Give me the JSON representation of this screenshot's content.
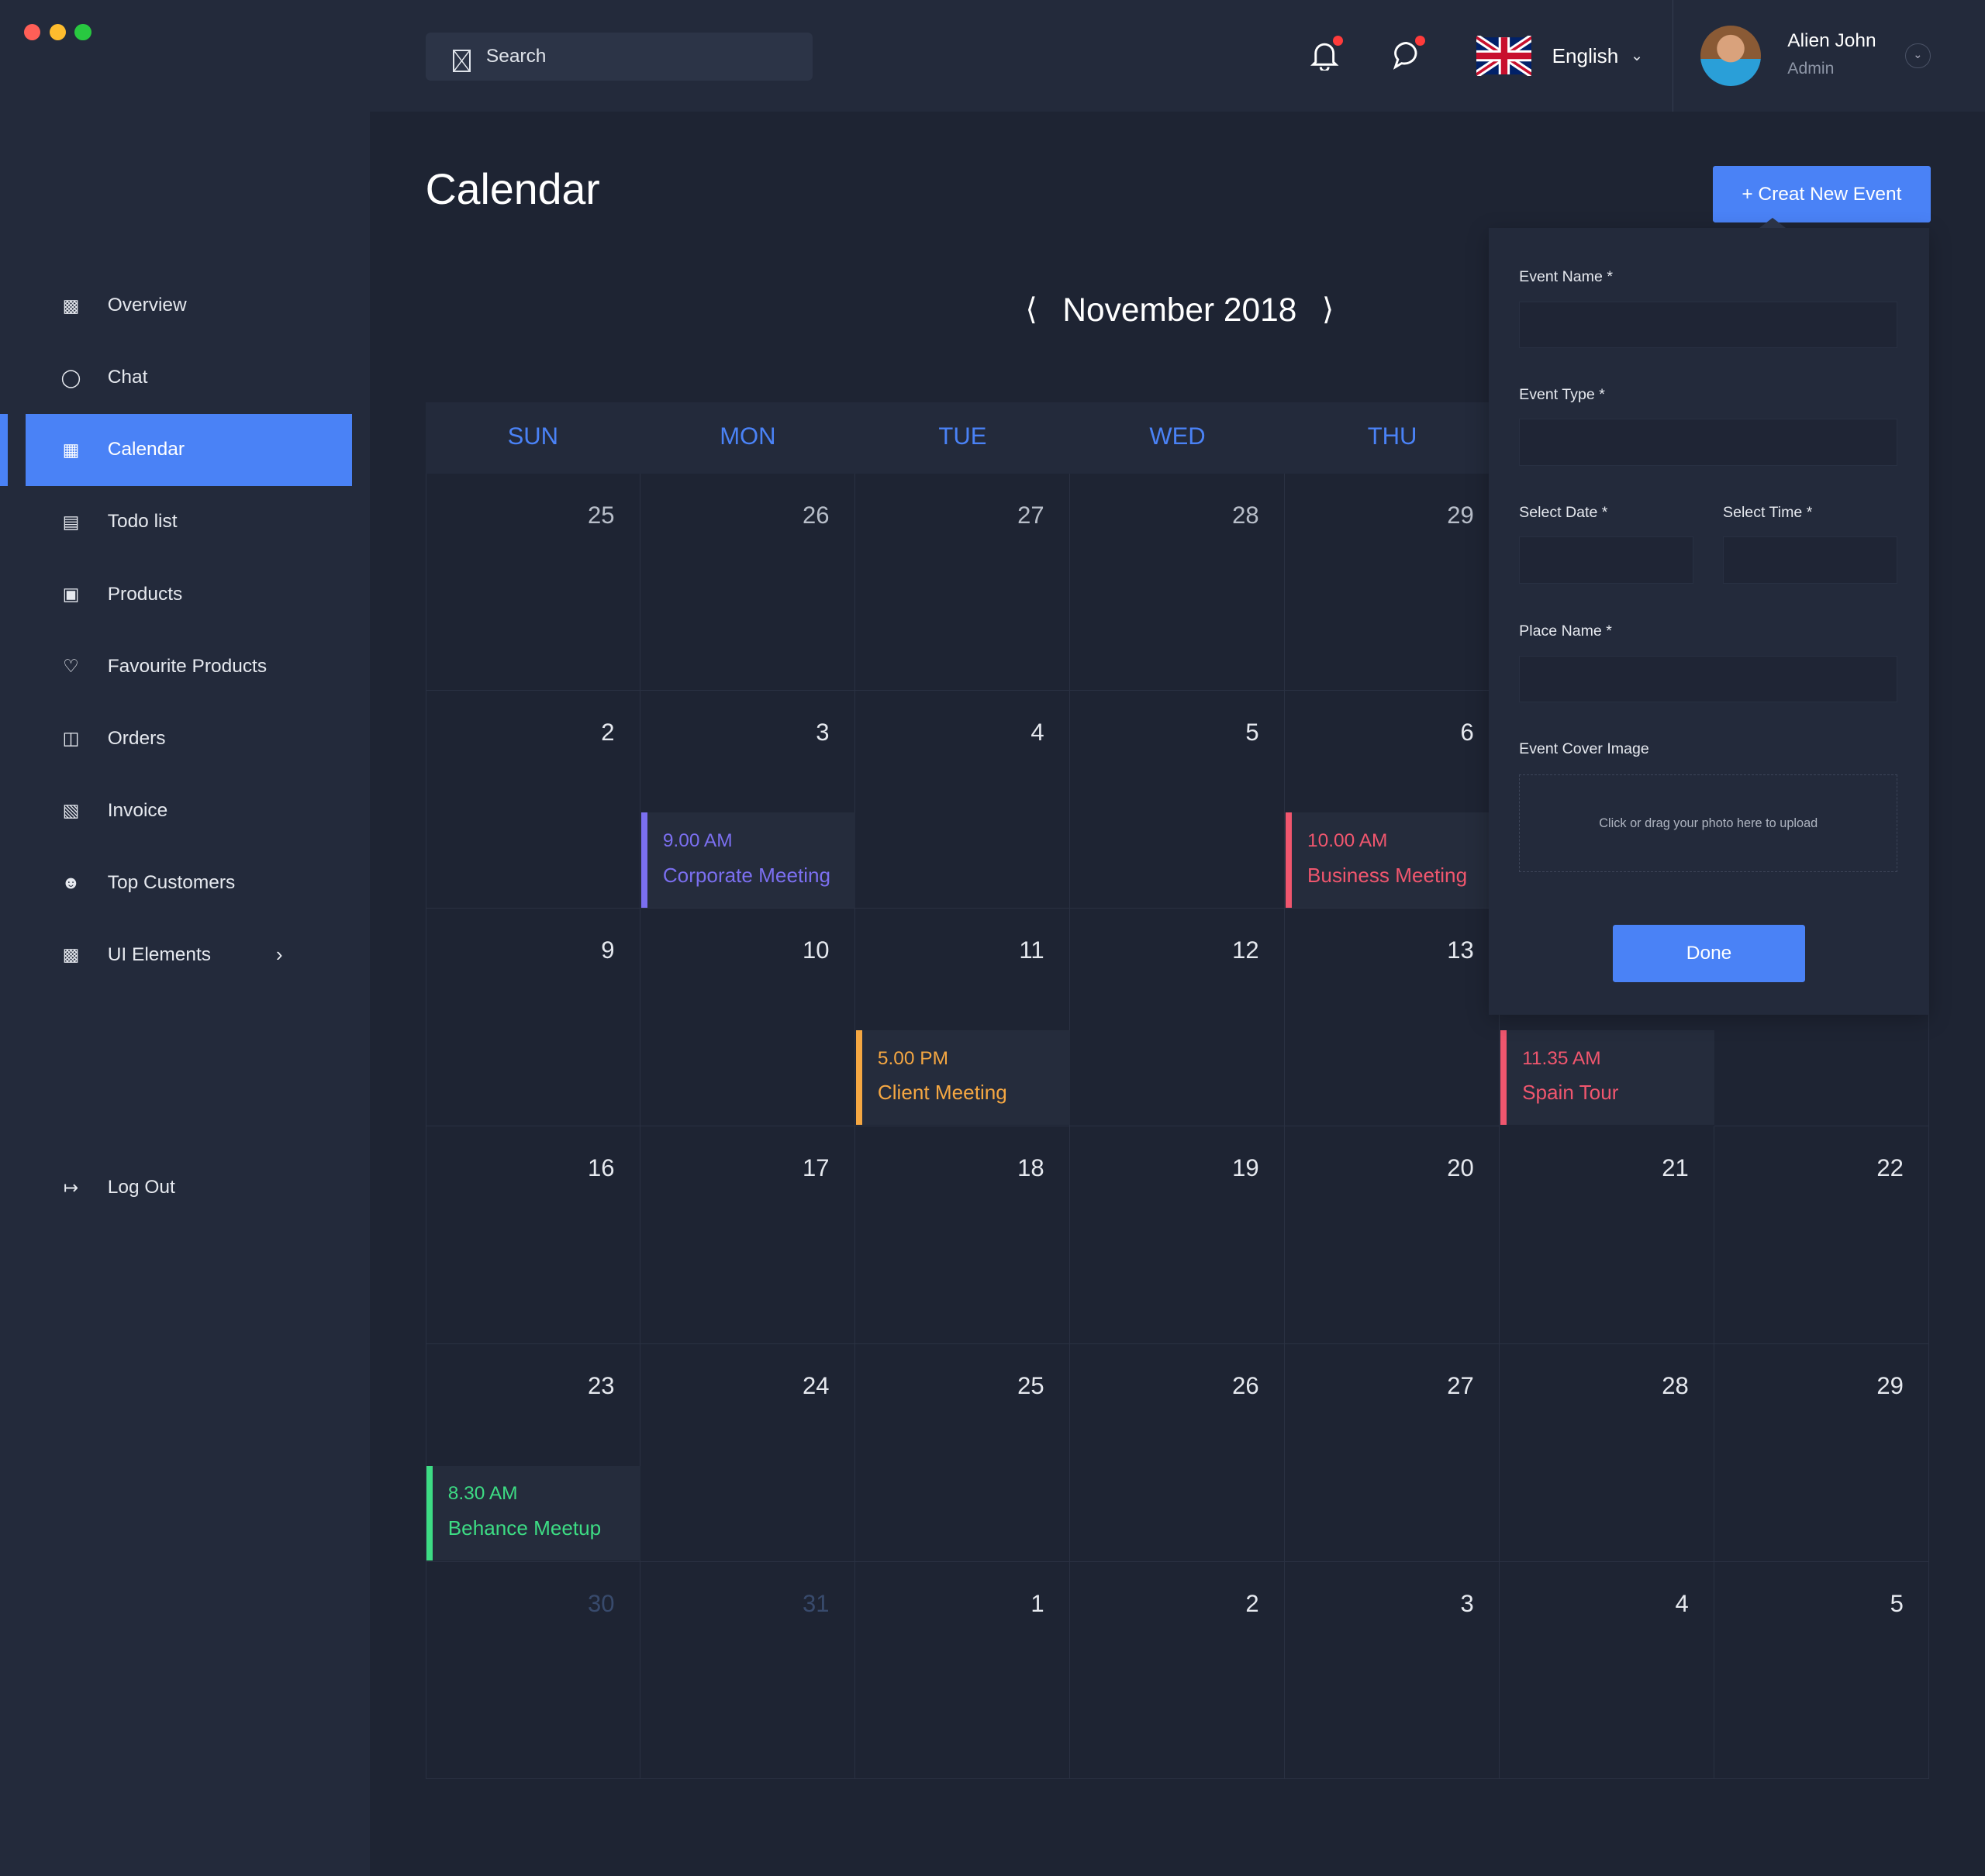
{
  "window": {
    "controls": [
      "close",
      "minimize",
      "maximize"
    ],
    "colors": [
      "#ff5f57",
      "#febc2e",
      "#28c840"
    ]
  },
  "header": {
    "search_placeholder": "Search",
    "language": "English",
    "user": {
      "name": "Alien John",
      "role": "Admin"
    },
    "notification_badge": true,
    "message_badge": true
  },
  "sidebar": {
    "items": [
      {
        "label": "Overview",
        "icon": "bar-chart-icon"
      },
      {
        "label": "Chat",
        "icon": "chat-icon"
      },
      {
        "label": "Calendar",
        "icon": "calendar-icon",
        "active": true
      },
      {
        "label": "Todo list",
        "icon": "document-icon"
      },
      {
        "label": "Products",
        "icon": "store-icon"
      },
      {
        "label": "Favourite Products",
        "icon": "heart-icon"
      },
      {
        "label": "Orders",
        "icon": "layout-icon"
      },
      {
        "label": "Invoice",
        "icon": "invoice-icon"
      },
      {
        "label": "Top Customers",
        "icon": "user-icon"
      },
      {
        "label": "UI Elements",
        "icon": "bar-chart-icon",
        "has_submenu": true
      }
    ],
    "logout": "Log Out"
  },
  "page": {
    "title": "Calendar",
    "new_event_button": "+ Creat New Event",
    "month": "November 2018"
  },
  "calendar": {
    "weekdays": [
      "SUN",
      "MON",
      "TUE",
      "WED",
      "THU"
    ],
    "weeks": [
      [
        {
          "d": "25",
          "s": "prev"
        },
        {
          "d": "26",
          "s": "prev"
        },
        {
          "d": "27",
          "s": "prev"
        },
        {
          "d": "28",
          "s": "prev"
        },
        {
          "d": "29",
          "s": "prev"
        },
        null,
        null
      ],
      [
        {
          "d": "2"
        },
        {
          "d": "3"
        },
        {
          "d": "4"
        },
        {
          "d": "5"
        },
        {
          "d": "6"
        },
        null,
        null
      ],
      [
        {
          "d": "9"
        },
        {
          "d": "10"
        },
        {
          "d": "11"
        },
        {
          "d": "12"
        },
        {
          "d": "13"
        },
        null,
        {
          "d": ""
        }
      ],
      [
        {
          "d": "16"
        },
        {
          "d": "17"
        },
        {
          "d": "18"
        },
        {
          "d": "19"
        },
        {
          "d": "20"
        },
        {
          "d": "21"
        },
        {
          "d": "22"
        }
      ],
      [
        {
          "d": "23"
        },
        {
          "d": "24"
        },
        {
          "d": "25"
        },
        {
          "d": "26"
        },
        {
          "d": "27"
        },
        {
          "d": "28"
        },
        {
          "d": "29"
        }
      ],
      [
        {
          "d": "30",
          "s": "mut"
        },
        {
          "d": "31",
          "s": "mut"
        },
        {
          "d": "1"
        },
        {
          "d": "2"
        },
        {
          "d": "3"
        },
        {
          "d": "4"
        },
        {
          "d": "5"
        }
      ]
    ],
    "events": [
      {
        "week": 1,
        "day": 1,
        "time": "9.00 AM",
        "name": "Corporate Meeting",
        "color": "#7b6ff0"
      },
      {
        "week": 1,
        "day": 4,
        "time": "10.00 AM",
        "name": "Business Meeting",
        "color": "#f0566e"
      },
      {
        "week": 2,
        "day": 2,
        "time": "5.00 PM",
        "name": "Client Meeting",
        "color": "#f5a742"
      },
      {
        "week": 2,
        "day": 5,
        "time": "11.35 AM",
        "name": "Spain Tour",
        "color": "#f0566e"
      },
      {
        "week": 4,
        "day": 0,
        "time": "8.30 AM",
        "name": "Behance Meetup",
        "color": "#3ddc84"
      }
    ]
  },
  "event_form": {
    "event_name_label": "Event Name *",
    "event_type_label": "Event Type *",
    "select_date_label": "Select Date *",
    "select_time_label": "Select Time *",
    "place_name_label": "Place Name *",
    "cover_image_label": "Event Cover Image",
    "upload_hint": "Click or drag your photo here to upload",
    "done_button": "Done"
  },
  "colors": {
    "accent": "#4a82f6",
    "sidebar": "#232a3b",
    "background": "#1e2433"
  }
}
